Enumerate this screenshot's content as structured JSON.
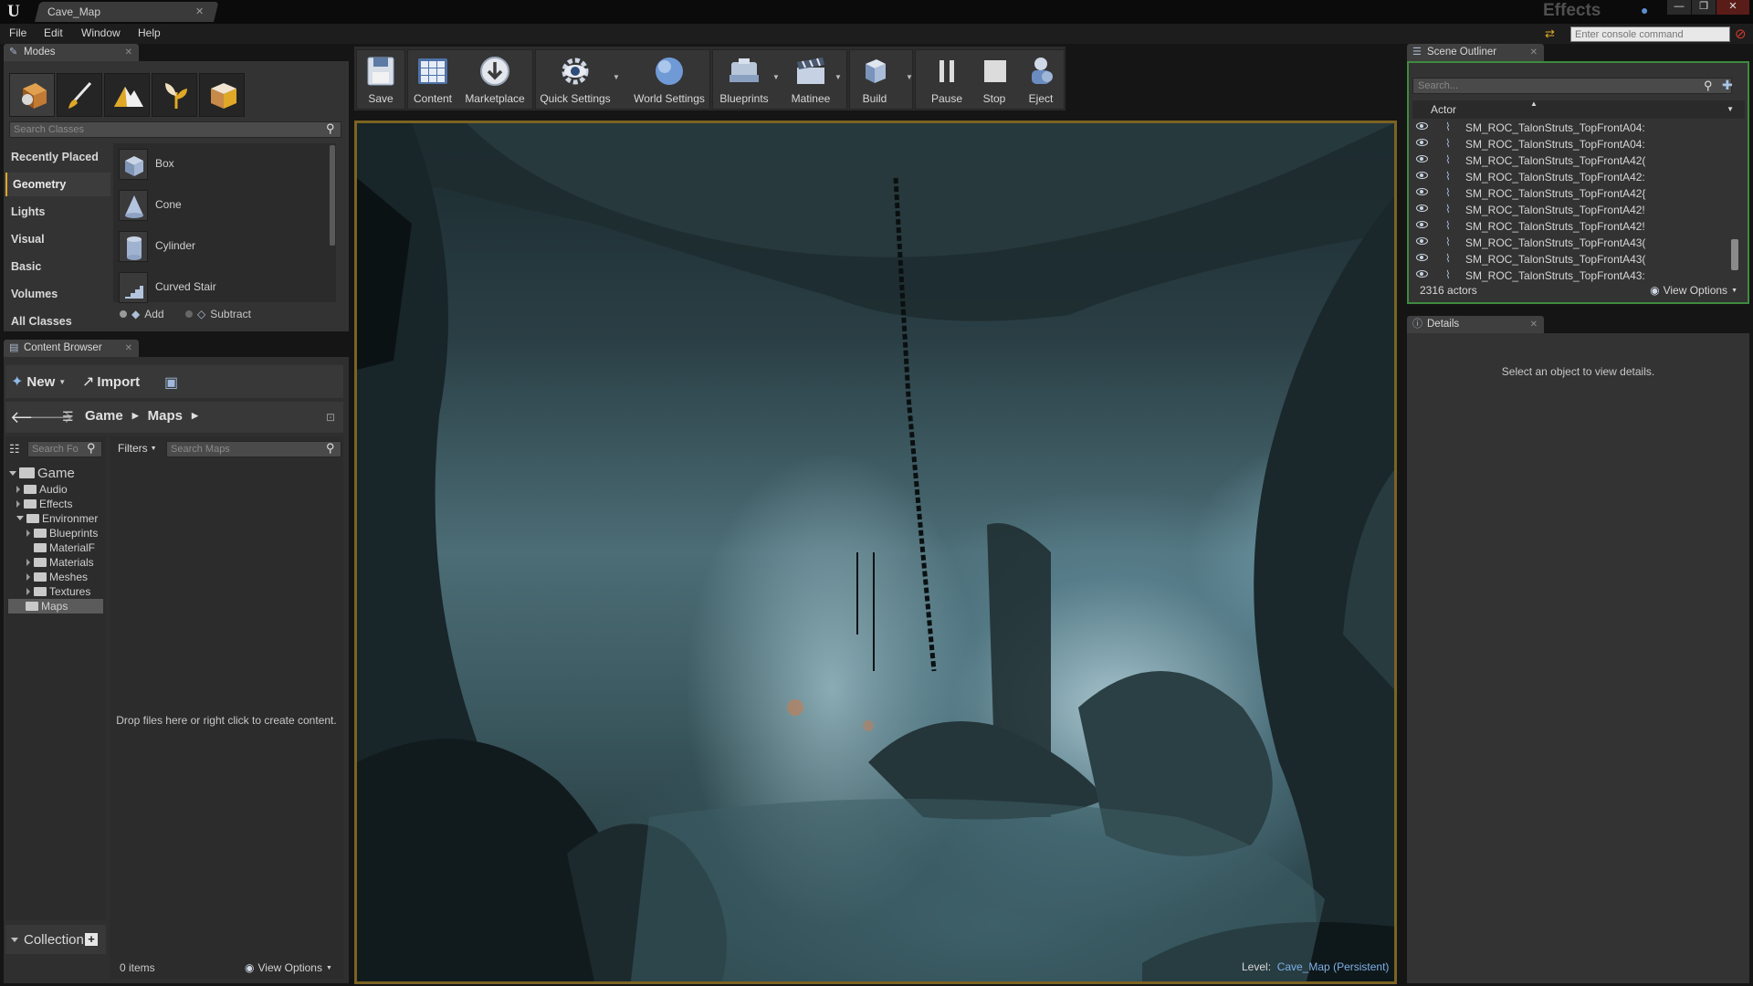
{
  "app": {
    "document_tab": "Cave_Map",
    "project_name": "Effects"
  },
  "menu": [
    "File",
    "Edit",
    "Window",
    "Help"
  ],
  "console": {
    "placeholder": "Enter console command"
  },
  "modes": {
    "tab_label": "Modes",
    "search_placeholder": "Search Classes",
    "categories": [
      "Recently Placed",
      "Geometry",
      "Lights",
      "Visual",
      "Basic",
      "Volumes",
      "All Classes"
    ],
    "selected_category": "Geometry",
    "classes": [
      "Box",
      "Cone",
      "Cylinder",
      "Curved Stair"
    ],
    "brush_add": "Add",
    "brush_subtract": "Subtract"
  },
  "content_browser": {
    "tab_label": "Content Browser",
    "new_label": "New",
    "import_label": "Import",
    "path": [
      "Game",
      "Maps"
    ],
    "search_folders_placeholder": "Search Fo",
    "filters_label": "Filters",
    "search_maps_placeholder": "Search Maps",
    "tree": {
      "root": "Game",
      "items": [
        "Audio",
        "Effects",
        "Environmer",
        "Blueprints",
        "MaterialF",
        "Materials",
        "Meshes",
        "Textures",
        "Maps"
      ]
    },
    "empty_message": "Drop files here or right click to create content.",
    "item_count": "0 items",
    "view_options": "View Options",
    "collections_label": "Collection"
  },
  "toolbar": {
    "save": "Save",
    "content": "Content",
    "marketplace": "Marketplace",
    "quick_settings": "Quick Settings",
    "world_settings": "World Settings",
    "blueprints": "Blueprints",
    "matinee": "Matinee",
    "build": "Build",
    "pause": "Pause",
    "stop": "Stop",
    "eject": "Eject"
  },
  "viewport": {
    "level_prefix": "Level:",
    "level_name": "Cave_Map (Persistent)"
  },
  "scene_outliner": {
    "tab_label": "Scene Outliner",
    "search_placeholder": "Search...",
    "column_header": "Actor",
    "rows": [
      "SM_ROC_TalonStruts_TopFrontA04:",
      "SM_ROC_TalonStruts_TopFrontA04:",
      "SM_ROC_TalonStruts_TopFrontA42(",
      "SM_ROC_TalonStruts_TopFrontA42:",
      "SM_ROC_TalonStruts_TopFrontA42{",
      "SM_ROC_TalonStruts_TopFrontA42!",
      "SM_ROC_TalonStruts_TopFrontA42!",
      "SM_ROC_TalonStruts_TopFrontA43(",
      "SM_ROC_TalonStruts_TopFrontA43(",
      "SM_ROC_TalonStruts_TopFrontA43:"
    ],
    "actor_count": "2316 actors",
    "view_options": "View Options"
  },
  "details": {
    "tab_label": "Details",
    "empty_message": "Select an object to view details."
  },
  "colors": {
    "accent_gold": "#e0a826",
    "link_blue": "#7fb0e6",
    "outliner_border": "#3f8a3f"
  }
}
